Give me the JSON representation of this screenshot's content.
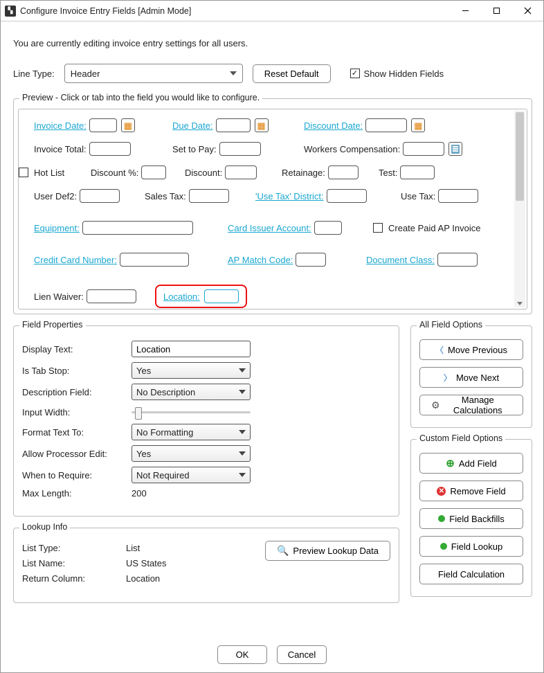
{
  "window": {
    "title": "Configure Invoice Entry Fields [Admin Mode]"
  },
  "info_line": "You are currently editing invoice entry settings for all users.",
  "line_type": {
    "label": "Line Type:",
    "value": "Header"
  },
  "reset_default": "Reset Default",
  "show_hidden": {
    "label": "Show Hidden Fields",
    "checked": true
  },
  "preview": {
    "legend": "Preview - Click or tab into the field you would like to configure.",
    "labels": {
      "invoice_date": "Invoice Date:",
      "due_date": "Due Date:",
      "discount_date": "Discount Date:",
      "invoice_total": "Invoice Total:",
      "set_to_pay": "Set to Pay:",
      "workers_comp": "Workers Compensation:",
      "hot_list": "Hot List",
      "discount_pct": "Discount %:",
      "discount": "Discount:",
      "retainage": "Retainage:",
      "test": "Test:",
      "user_def2": "User Def2:",
      "sales_tax": "Sales Tax:",
      "use_tax_district": "'Use Tax' District:",
      "use_tax": "Use Tax:",
      "equipment": "Equipment:",
      "card_issuer": "Card Issuer Account:",
      "create_paid_ap": "Create Paid AP Invoice",
      "cc_number": "Credit Card Number:",
      "ap_match": "AP Match Code:",
      "doc_class": "Document Class:",
      "lien_waiver": "Lien Waiver:",
      "location": "Location:"
    }
  },
  "field_props": {
    "legend": "Field Properties",
    "display_text": {
      "label": "Display Text:",
      "value": "Location"
    },
    "is_tab_stop": {
      "label": "Is Tab Stop:",
      "value": "Yes"
    },
    "description_field": {
      "label": "Description Field:",
      "value": "No Description"
    },
    "input_width": {
      "label": "Input Width:"
    },
    "format_text": {
      "label": "Format Text To:",
      "value": "No Formatting"
    },
    "allow_processor": {
      "label": "Allow Processor Edit:",
      "value": "Yes"
    },
    "when_require": {
      "label": "When to Require:",
      "value": "Not Required"
    },
    "max_length": {
      "label": "Max Length:",
      "value": "200"
    }
  },
  "all_field_options": {
    "legend": "All Field Options",
    "move_previous": "Move Previous",
    "move_next": "Move Next",
    "manage_calc": "Manage Calculations"
  },
  "custom_field_options": {
    "legend": "Custom Field Options",
    "add_field": "Add Field",
    "remove_field": "Remove Field",
    "field_backfills": "Field Backfills",
    "field_lookup": "Field Lookup",
    "field_calc": "Field Calculation"
  },
  "lookup": {
    "legend": "Lookup Info",
    "list_type": {
      "label": "List Type:",
      "value": "List"
    },
    "list_name": {
      "label": "List Name:",
      "value": "US States"
    },
    "return_column": {
      "label": "Return Column:",
      "value": "Location"
    },
    "preview_button": "Preview Lookup Data"
  },
  "footer": {
    "ok": "OK",
    "cancel": "Cancel"
  }
}
